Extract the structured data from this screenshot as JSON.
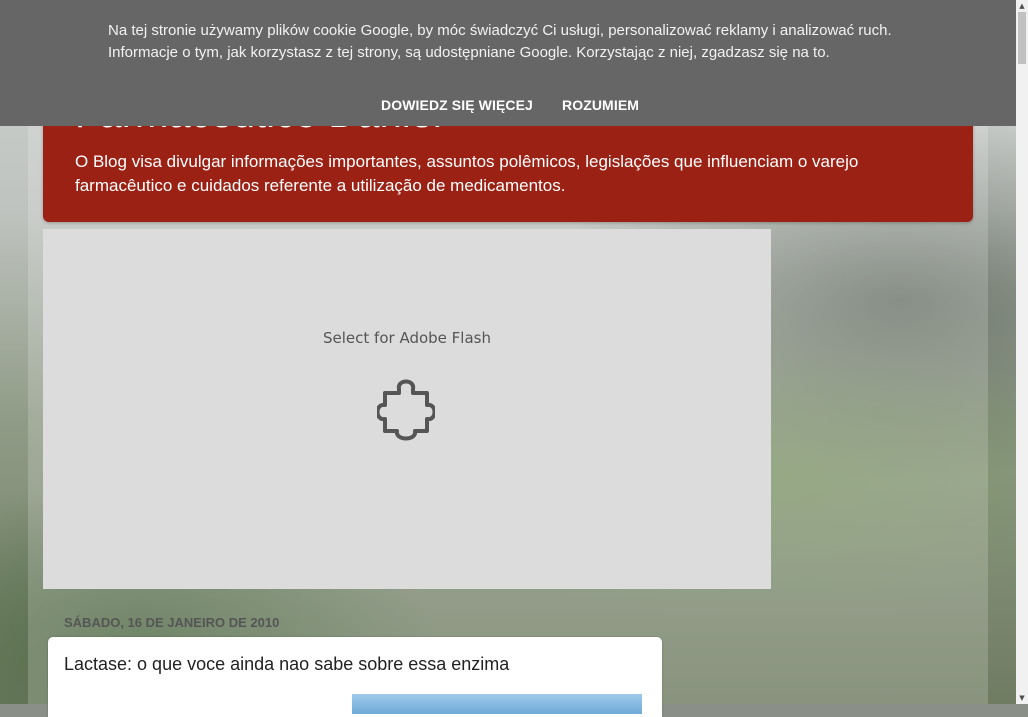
{
  "cookie_banner": {
    "message": "Na tej stronie używamy plików cookie Google, by móc świadczyć Ci usługi, personalizować reklamy i analizować ruch. Informacje o tym, jak korzystasz z tej strony, są udostępniane Google. Korzystając z niej, zgadzasz się na to.",
    "learn_more_label": "DOWIEDZ SIĘ WIĘCEJ",
    "accept_label": "ROZUMIEM"
  },
  "header": {
    "title": "Farmacêutico Daniel",
    "description": "O Blog visa divulgar informações importantes, assuntos polêmicos, legislações que influenciam o varejo farmacêutico e cuidados referente a utilização de medicamentos."
  },
  "flash_plugin": {
    "label": "Select for Adobe Flash",
    "icon": "puzzle-piece-icon"
  },
  "post": {
    "date": "SÁBADO, 16 DE JANEIRO DE 2010",
    "title": "Lactase: o que voce ainda nao sabe sobre essa enzima"
  },
  "scrollbar": {
    "up_icon": "scroll-up-arrow-icon",
    "down_icon": "scroll-down-arrow-icon"
  },
  "colors": {
    "header_bg": "#9b2114",
    "cookie_bar_bg": "#666666",
    "flash_bg": "#dcdcdc"
  }
}
